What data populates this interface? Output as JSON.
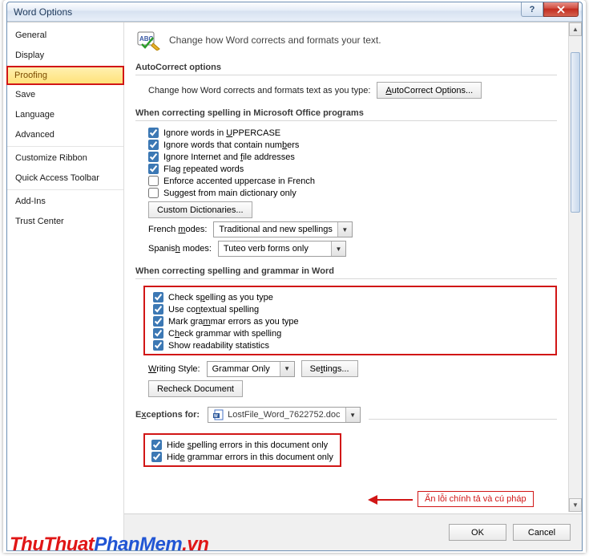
{
  "window": {
    "title": "Word Options"
  },
  "sidebar": {
    "items": [
      {
        "label": "General"
      },
      {
        "label": "Display"
      },
      {
        "label": "Proofing",
        "selected": true
      },
      {
        "label": "Save"
      },
      {
        "label": "Language"
      },
      {
        "label": "Advanced",
        "sep_after": true
      },
      {
        "label": "Customize Ribbon"
      },
      {
        "label": "Quick Access Toolbar",
        "sep_after": true
      },
      {
        "label": "Add-Ins"
      },
      {
        "label": "Trust Center"
      }
    ]
  },
  "main": {
    "headline": "Change how Word corrects and formats your text.",
    "sections": {
      "autocorrect": {
        "title": "AutoCorrect options",
        "desc": "Change how Word corrects and formats text as you type:",
        "button": "AutoCorrect Options..."
      },
      "office_spelling": {
        "title": "When correcting spelling in Microsoft Office programs",
        "checks": [
          {
            "label_html": "Ignore words in <u>U</u>PPERCASE",
            "checked": true
          },
          {
            "label_html": "Ignore words that contain num<u>b</u>ers",
            "checked": true
          },
          {
            "label_html": "Ignore Internet and <u>f</u>ile addresses",
            "checked": true
          },
          {
            "label_html": "Flag <u>r</u>epeated words",
            "checked": true
          },
          {
            "label_html": "Enforce accented uppercase in French",
            "checked": false
          },
          {
            "label_html": "Suggest from main dictionary only",
            "checked": false
          }
        ],
        "dict_button": "Custom Dictionaries...",
        "french_label_html": "French <u>m</u>odes:",
        "french_value": "Traditional and new spellings",
        "spanish_label_html": "Spanis<u>h</u> modes:",
        "spanish_value": "Tuteo verb forms only"
      },
      "word_spelling": {
        "title": "When correcting spelling and grammar in Word",
        "checks": [
          {
            "label_html": "Check s<u>p</u>elling as you type",
            "checked": true
          },
          {
            "label_html": "Use co<u>n</u>textual spelling",
            "checked": true
          },
          {
            "label_html": "Mark gra<u>m</u>mar errors as you type",
            "checked": true
          },
          {
            "label_html": "C<u>h</u>eck grammar with spelling",
            "checked": true
          },
          {
            "label_html": "Show readability statistics",
            "checked": true
          }
        ],
        "writing_style_label_html": "<u>W</u>riting Style:",
        "writing_style_value": "Grammar Only",
        "settings_button_html": "Se<u>t</u>tings...",
        "recheck_button": "Recheck Document"
      },
      "exceptions": {
        "label_html": "E<u>x</u>ceptions for:",
        "file": "LostFile_Word_7622752.doc",
        "checks": [
          {
            "label_html": "Hide <u>s</u>pelling errors in this document only",
            "checked": true
          },
          {
            "label_html": "Hid<u>e</u> grammar errors in this document only",
            "checked": true
          }
        ]
      }
    }
  },
  "buttons": {
    "ok": "OK",
    "cancel": "Cancel"
  },
  "annotation": {
    "text": "Ẩn lỗi chính tả và cú pháp"
  },
  "watermark": {
    "part1": "ThuThuat",
    "part2": "PhanMem",
    "part3": ".vn"
  }
}
